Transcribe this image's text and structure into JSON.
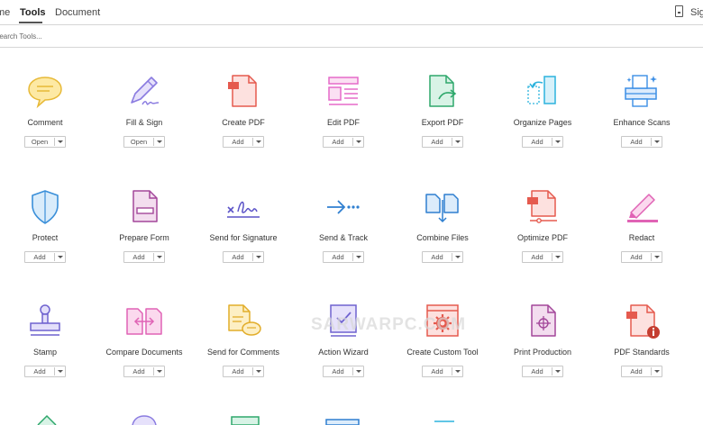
{
  "tabs": [
    {
      "label": "me",
      "active": false
    },
    {
      "label": "Tools",
      "active": true
    },
    {
      "label": "Document",
      "active": false
    }
  ],
  "sign_label": "Sig",
  "search": {
    "placeholder": "Search Tools..."
  },
  "watermark": "SARWARPC.COM",
  "tools": [
    {
      "label": "Comment",
      "button": "Open",
      "icon": "comment-icon"
    },
    {
      "label": "Fill & Sign",
      "button": "Open",
      "icon": "fill-sign-icon"
    },
    {
      "label": "Create PDF",
      "button": "Add",
      "icon": "create-pdf-icon"
    },
    {
      "label": "Edit PDF",
      "button": "Add",
      "icon": "edit-pdf-icon"
    },
    {
      "label": "Export PDF",
      "button": "Add",
      "icon": "export-pdf-icon"
    },
    {
      "label": "Organize Pages",
      "button": "Add",
      "icon": "organize-pages-icon"
    },
    {
      "label": "Enhance Scans",
      "button": "Add",
      "icon": "enhance-scans-icon"
    },
    {
      "label": "Protect",
      "button": "Add",
      "icon": "shield-icon"
    },
    {
      "label": "Prepare Form",
      "button": "Add",
      "icon": "prepare-form-icon"
    },
    {
      "label": "Send for Signature",
      "button": "Add",
      "icon": "signature-icon"
    },
    {
      "label": "Send & Track",
      "button": "Add",
      "icon": "send-track-icon"
    },
    {
      "label": "Combine Files",
      "button": "Add",
      "icon": "combine-files-icon"
    },
    {
      "label": "Optimize PDF",
      "button": "Add",
      "icon": "optimize-pdf-icon"
    },
    {
      "label": "Redact",
      "button": "Add",
      "icon": "redact-icon"
    },
    {
      "label": "Stamp",
      "button": "Add",
      "icon": "stamp-icon"
    },
    {
      "label": "Compare Documents",
      "button": "Add",
      "icon": "compare-documents-icon"
    },
    {
      "label": "Send for Comments",
      "button": "Add",
      "icon": "send-comments-icon"
    },
    {
      "label": "Action Wizard",
      "button": "Add",
      "icon": "action-wizard-icon"
    },
    {
      "label": "Create Custom Tool",
      "button": "Add",
      "icon": "custom-tool-icon"
    },
    {
      "label": "Print Production",
      "button": "Add",
      "icon": "print-production-icon"
    },
    {
      "label": "PDF Standards",
      "button": "Add",
      "icon": "pdf-standards-icon"
    }
  ]
}
